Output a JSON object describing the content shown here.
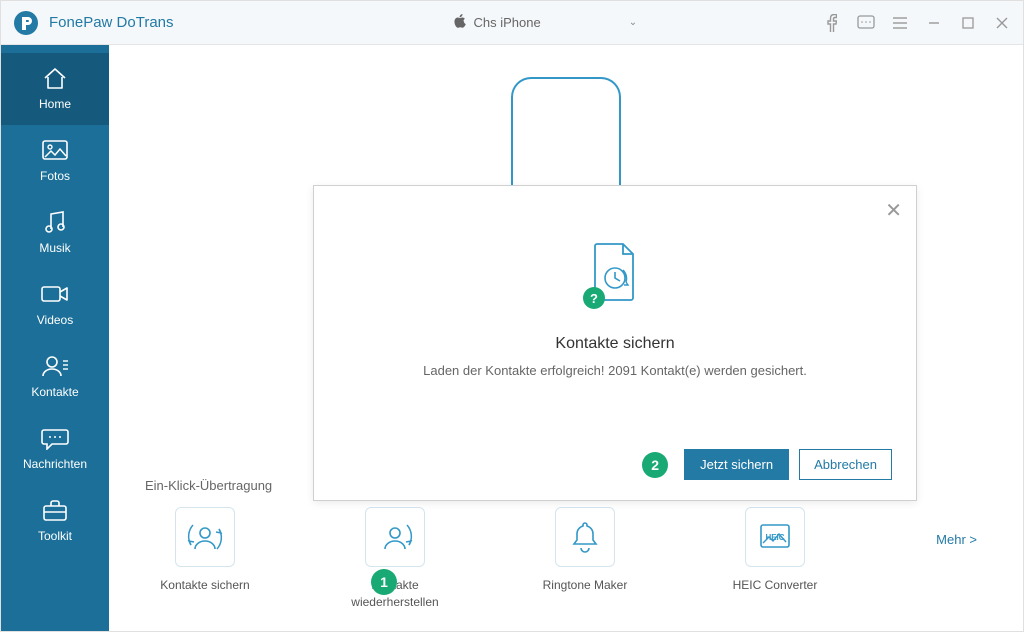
{
  "app": {
    "title": "FonePaw DoTrans",
    "device": "Chs iPhone"
  },
  "sidebar": {
    "items": [
      {
        "label": "Home"
      },
      {
        "label": "Fotos"
      },
      {
        "label": "Musik"
      },
      {
        "label": "Videos"
      },
      {
        "label": "Kontakte"
      },
      {
        "label": "Nachrichten"
      },
      {
        "label": "Toolkit"
      }
    ]
  },
  "main": {
    "section_label": "Ein-Klick-Übertragung",
    "grid": [
      {
        "label": "Kontakte sichern"
      },
      {
        "label": "Kontakte wiederherstellen"
      },
      {
        "label": "Ringtone Maker"
      },
      {
        "label": "HEIC Converter"
      }
    ],
    "more": "Mehr  >"
  },
  "modal": {
    "title": "Kontakte sichern",
    "desc": "Laden der Kontakte erfolgreich! 2091 Kontakt(e) werden gesichert.",
    "primary": "Jetzt sichern",
    "secondary": "Abbrechen"
  },
  "annotations": {
    "step1": "1",
    "step2": "2"
  }
}
